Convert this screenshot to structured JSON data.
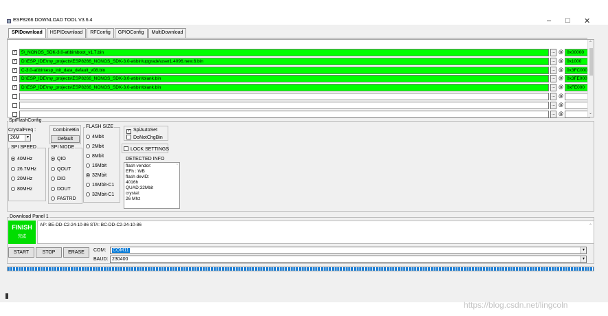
{
  "window": {
    "title": "ESP8266 DOWNLOAD TOOL V3.6.4",
    "controls": {
      "minimize": "–",
      "maximize": "□",
      "close": "✕"
    }
  },
  "tabs": [
    "SPIDownload",
    "HSPIDownload",
    "RFConfig",
    "GPIOConfig",
    "MultiDownload"
  ],
  "files": [
    {
      "checked": true,
      "path": "5\\_NONOS_SDK-3.0-at\\bin\\boot_v1.7.bin",
      "addr": "0x00000",
      "green": true
    },
    {
      "checked": true,
      "path": "D:\\ESP_IDE\\my_projects\\ESP8266_NONOS_SDK-3.0-at\\bin\\upgrade\\user1.4096.new.6.bin",
      "addr": "0x1000",
      "green": true
    },
    {
      "checked": true,
      "path": "C-3.0-at\\bin\\esp_init_data_default_v08.bin",
      "addr": "0x3FC000",
      "green": true
    },
    {
      "checked": true,
      "path": "D:\\ESP_IDE\\my_projects\\ESP8266_NONOS_SDK-3.0-at\\bin\\blank.bin",
      "addr": "0x3FE000",
      "green": true
    },
    {
      "checked": true,
      "path": "D:\\ESP_IDE\\my_projects\\ESP8266_NONOS_SDK-3.0-at\\bin\\blank.bin",
      "addr": "0xFE000",
      "green": true
    },
    {
      "checked": false,
      "path": "",
      "addr": "",
      "green": false
    },
    {
      "checked": false,
      "path": "",
      "addr": "",
      "green": false
    },
    {
      "checked": false,
      "path": "",
      "addr": "",
      "green": false
    }
  ],
  "file_row_labels": {
    "browse": "...",
    "at": "@"
  },
  "spi": {
    "group_label": "SpiFlashConfig",
    "crystal_label": "CrystalFreq :",
    "crystal_value": "26M",
    "combinebin_label": "CombineBin",
    "default_label": "Default",
    "spi_speed_label": "SPI SPEED",
    "spi_speed_options": [
      "40MHz",
      "26.7MHz",
      "20MHz",
      "80MHz"
    ],
    "spi_speed_selected": "40MHz",
    "spi_mode_label": "SPI MODE",
    "spi_mode_options": [
      "QIO",
      "QOUT",
      "DIO",
      "DOUT",
      "FASTRD"
    ],
    "spi_mode_selected": "QIO",
    "flash_size_label": "FLASH SIZE",
    "flash_size_options": [
      "4Mbit",
      "2Mbit",
      "8Mbit",
      "16Mbit",
      "32Mbit",
      "16Mbit-C1",
      "32Mbit-C1"
    ],
    "flash_size_selected": "32Mbit",
    "spi_auto_set": "SpiAutoSet",
    "spi_auto_set_checked": true,
    "do_not_chg_bin": "DoNotChgBin",
    "do_not_chg_bin_checked": false,
    "lock_settings": "LOCK SETTINGS",
    "lock_settings_checked": false,
    "detected_info_label": "DETECTED INFO",
    "detected_info_lines": [
      "flash vendor:",
      "EFh : WB",
      "flash devID:",
      "4016h",
      "QUAD;32Mbit",
      "crystal:",
      "26 Mhz"
    ]
  },
  "download": {
    "panel_label": "Download Panel 1",
    "status": "FINISH",
    "status_sub": "完成",
    "log": "AP:  BE-DD-C2-24-10-86   STA:  BC-DD-C2-24-10-86",
    "start": "START",
    "stop": "STOP",
    "erase": "ERASE",
    "com_label": "COM:",
    "com_value": "COM11",
    "baud_label": "BAUD:",
    "baud_value": "230400",
    "progress_pct": 100
  },
  "watermark": "https://blog.csdn.net/lingcoln",
  "colors": {
    "green": "#00ff00",
    "finish": "#00dd00",
    "progress": "#1d7fd6",
    "selection": "#0078d7"
  }
}
